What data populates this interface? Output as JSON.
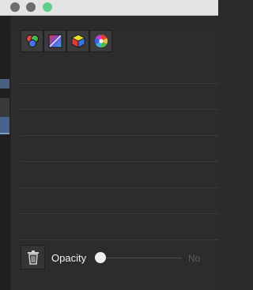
{
  "window": {
    "traffic_lights": [
      {
        "name": "close",
        "color": "#6c6c6c"
      },
      {
        "name": "minimize",
        "color": "#6c6c6c"
      },
      {
        "name": "zoom",
        "color": "#5ecf89"
      }
    ]
  },
  "toolbar": {
    "buttons": [
      {
        "icon": "rgb-circles-icon"
      },
      {
        "icon": "gradient-square-icon"
      },
      {
        "icon": "color-cube-icon"
      },
      {
        "icon": "color-wheel-icon"
      }
    ]
  },
  "list": {
    "row_count": 7
  },
  "footer": {
    "trash_icon": "trash-icon",
    "opacity_label": "Opacity",
    "opacity_value_text": "No",
    "opacity_level": 0
  }
}
